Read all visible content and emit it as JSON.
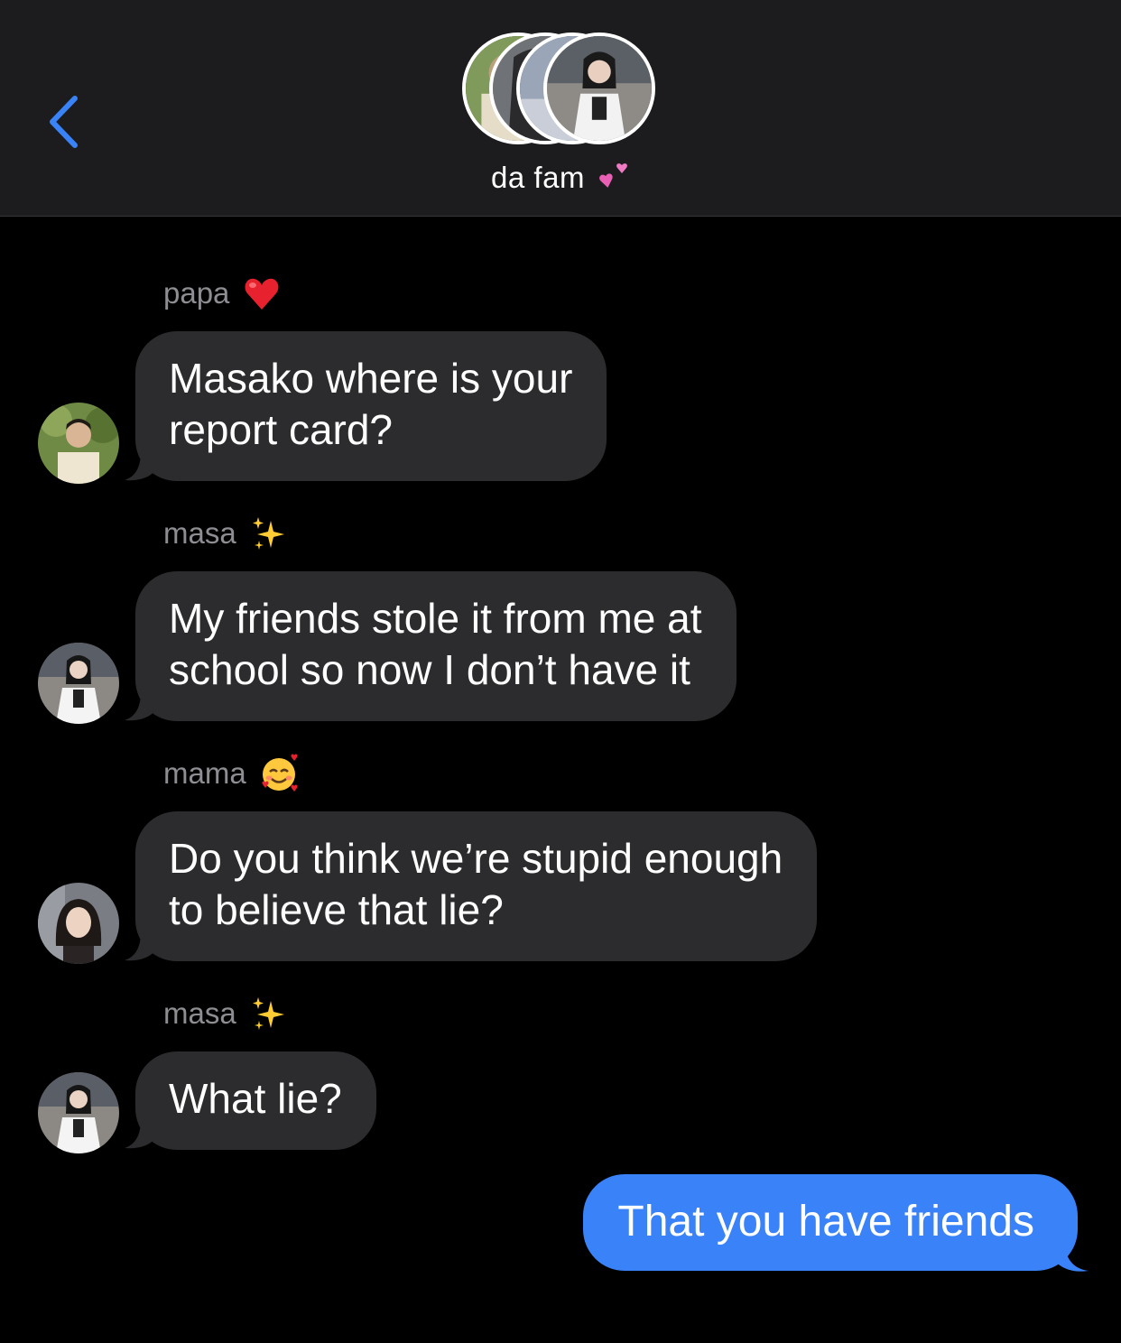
{
  "header": {
    "back_icon": "chevron-left-icon",
    "group_name": "da fam",
    "group_emoji": "two-hearts-icon",
    "accent_color": "#3a82f7"
  },
  "messages": [
    {
      "sender": "papa",
      "sender_emoji": "red-heart-icon",
      "text_lines": [
        "Masako where is your",
        "report card?"
      ]
    },
    {
      "sender": "masa",
      "sender_emoji": "sparkles-icon",
      "text_lines": [
        "My friends stole it from me at",
        "school so now I don’t have it"
      ]
    },
    {
      "sender": "mama",
      "sender_emoji": "smiling-face-with-hearts-icon",
      "text_lines": [
        "Do you think we’re stupid enough",
        "to believe that lie?"
      ]
    },
    {
      "sender": "masa",
      "sender_emoji": "sparkles-icon",
      "text_lines": [
        "What lie?"
      ]
    }
  ],
  "outgoing": {
    "text": "That you have friends",
    "color": "#3a82f7"
  }
}
